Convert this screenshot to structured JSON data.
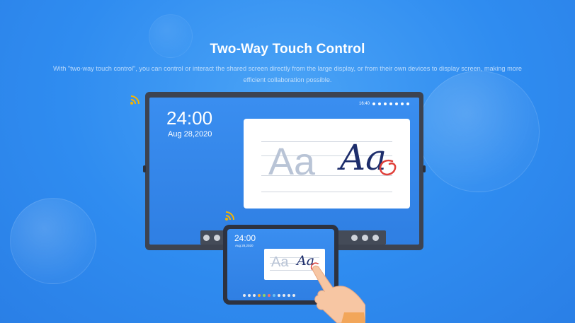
{
  "headline": "Two-Way Touch Control",
  "description": "With \"two-way touch control\", you can control or interact the shared screen directly from the large display, or from their own devices to display screen, making more efficient collaboration possible.",
  "large_display": {
    "time": "24:00",
    "date": "Aug 28,2020",
    "status_time": "16:40",
    "card_print_text": "Aa",
    "card_script_text": "Aa"
  },
  "tablet": {
    "time": "24:00",
    "date": "Aug 28,2020",
    "card_print_text": "Aa",
    "card_script_text": "Aa"
  },
  "icons": {
    "cast_signal": "wifi-broadcast-icon",
    "hand": "pointing-hand-icon"
  },
  "colors": {
    "background": "#2f8cf0",
    "script_ink": "#1d2d6b",
    "circle_mark": "#e0403a",
    "display_frame": "#3d4350"
  }
}
